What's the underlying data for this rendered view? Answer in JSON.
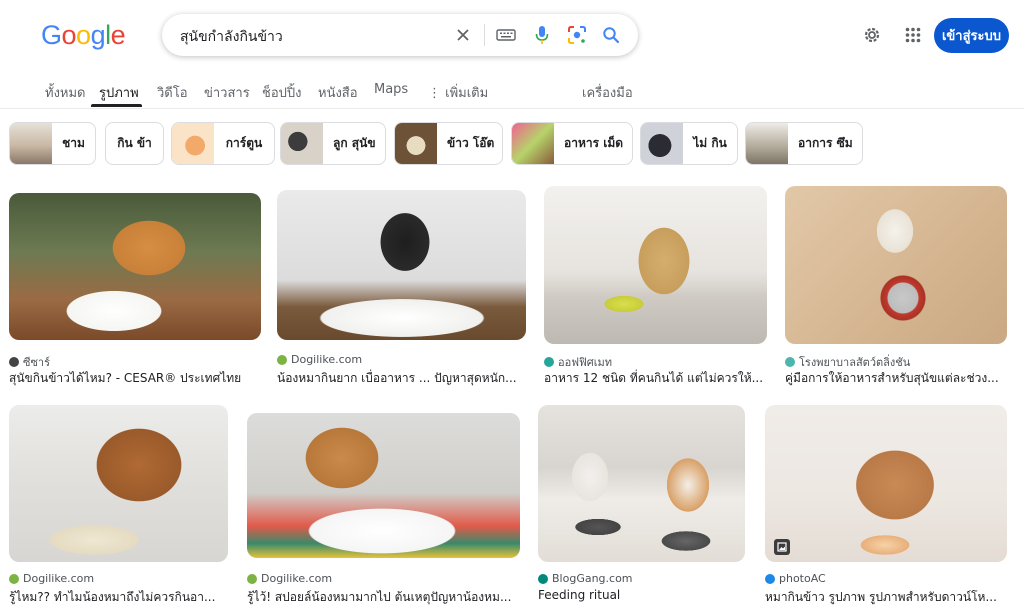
{
  "header": {
    "logo_letters": [
      "G",
      "o",
      "o",
      "g",
      "l",
      "e"
    ],
    "logo_colors": [
      "#4285F4",
      "#EA4335",
      "#FBBC05",
      "#4285F4",
      "#34A853",
      "#EA4335"
    ],
    "query": "สุนัขกำลังกินข้าว",
    "signin_label": "เข้าสู่ระบบ"
  },
  "tabs": [
    {
      "label": "ทั้งหมด",
      "active": false
    },
    {
      "label": "รูปภาพ",
      "active": true
    },
    {
      "label": "วิดีโอ",
      "active": false
    },
    {
      "label": "ข่าวสาร",
      "active": false
    },
    {
      "label": "ช็อปปิ้ง",
      "active": false
    },
    {
      "label": "หนังสือ",
      "active": false
    },
    {
      "label": "Maps",
      "active": false
    },
    {
      "label": "⋮ เพิ่มเติม",
      "active": false
    },
    {
      "label": "เครื่องมือ",
      "active": false
    }
  ],
  "chips": [
    {
      "label": "ชาม",
      "thumb_color": "#c9b8a4"
    },
    {
      "label": "กิน ข้า",
      "thumb_color": ""
    },
    {
      "label": "การ์ตูน",
      "thumb_color": "#f2c9a0"
    },
    {
      "label": "ลูก สุนัข",
      "thumb_color": "#5a5a5a"
    },
    {
      "label": "ข้าว โอ๊ต",
      "thumb_color": "#8a6a4a"
    },
    {
      "label": "อาหาร เม็ด",
      "thumb_color": "#d96a8a"
    },
    {
      "label": "ไม่ กิน",
      "thumb_color": "#3a3a44"
    },
    {
      "label": "อาการ ซึม",
      "thumb_color": "#b0a898"
    }
  ],
  "results": [
    {
      "source": "ซีซาร์",
      "caption": "สุนัขกินข้าวได้ไหม? - CESAR® ประเทศไทย",
      "favicon_color": "#444444"
    },
    {
      "source": "Dogilike.com",
      "caption": "น้องหมากินยาก เบื่ออาหาร ... ปัญหาสุดหนัก...",
      "favicon_color": "#7cb342"
    },
    {
      "source": "ออฟฟิศเมท",
      "caption": "อาหาร 12 ชนิด ที่คนกินได้ แต่ไม่ควรให้...",
      "favicon_color": "#26a69a"
    },
    {
      "source": "โรงพยาบาลสัตว์ตลิ่งชัน",
      "caption": "คู่มือการให้อาหารสำหรับสุนัขแต่ละช่วง...",
      "favicon_color": "#4db6ac"
    },
    {
      "source": "Dogilike.com",
      "caption": "รู้ไหม?? ทำไมน้องหมาถึงไม่ควรกินอา...",
      "favicon_color": "#7cb342"
    },
    {
      "source": "Dogilike.com",
      "caption": "รู้ไว้! สปอยล์น้องหมามากไป ต้นเหตุปัญหาน้องหม...",
      "favicon_color": "#7cb342"
    },
    {
      "source": "BlogGang.com",
      "caption": "Feeding ritual",
      "favicon_color": "#00897b"
    },
    {
      "source": "photoAC",
      "caption": "หมากินข้าว รูปภาพ รูปภาพสำหรับดาวน์โห...",
      "favicon_color": "#1e88e5"
    }
  ]
}
